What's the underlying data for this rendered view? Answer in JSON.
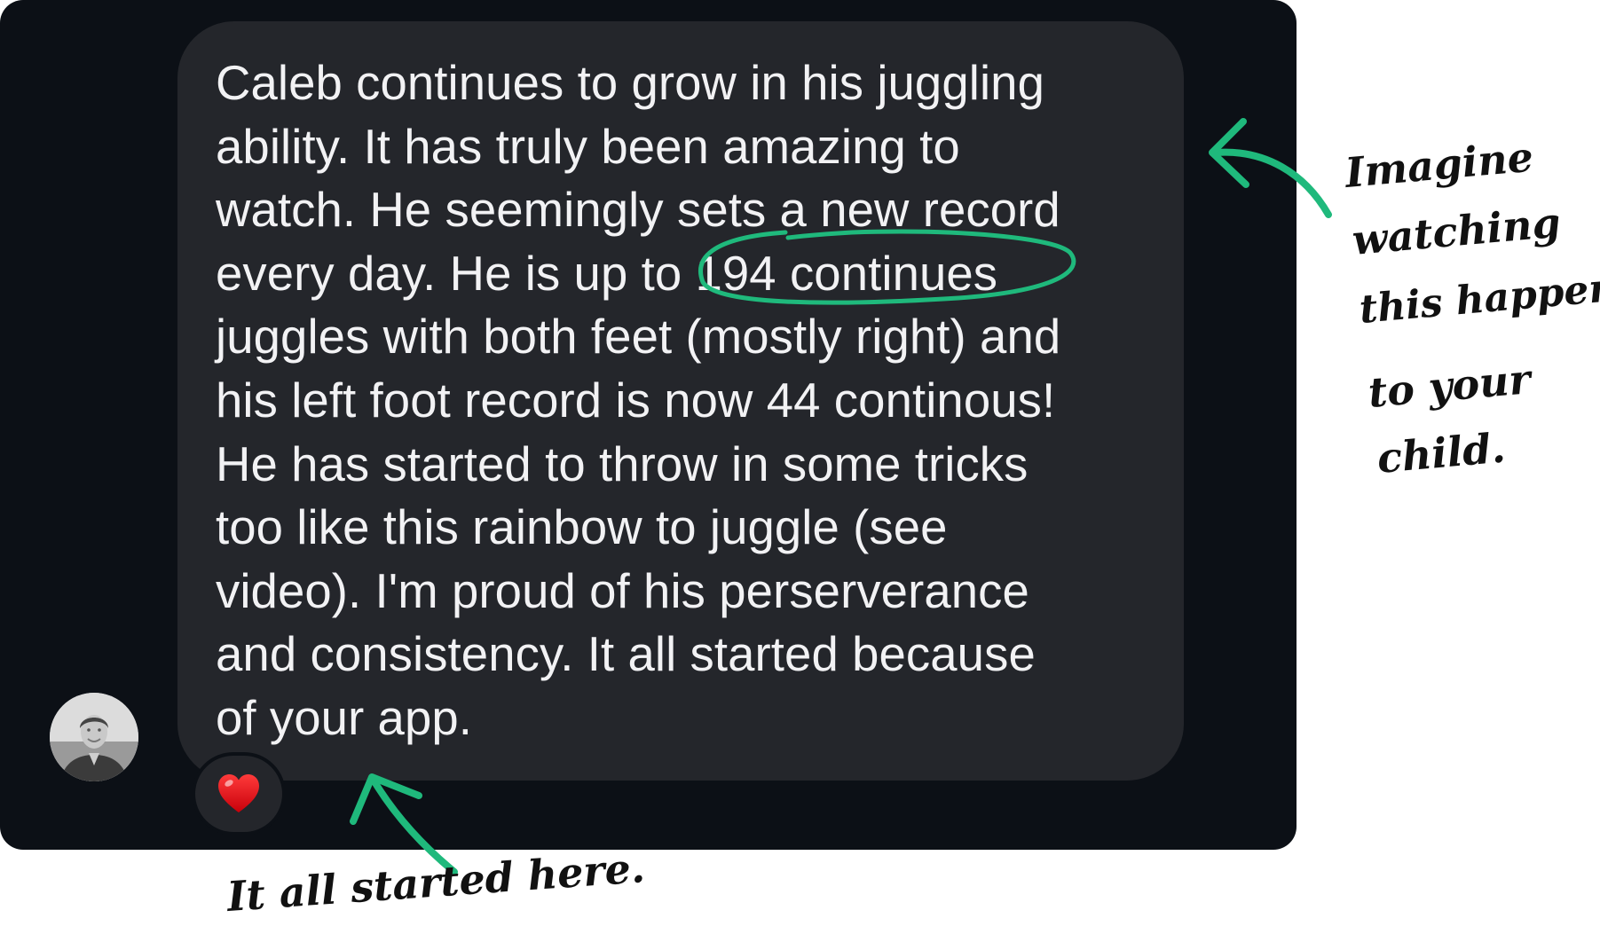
{
  "message": {
    "text": "Caleb continues to grow in his juggling\nability. It has truly been amazing to\nwatch. He seemingly sets a new record\nevery day. He is up to 194 continues\njuggles with both feet (mostly right) and\nhis left foot record is now 44 continous!\nHe has started to throw in some tricks\ntoo like this rainbow to juggle (see\nvideo). I'm proud of his perserverance\nand consistency. It all started because\nof your app."
  },
  "reaction": {
    "icon": "heart-icon",
    "color": "#e8141b"
  },
  "annotations": {
    "accent_color": "#1fb97c",
    "right_note": [
      "Imagine",
      "watching",
      "this happen",
      "to your",
      "child."
    ],
    "bottom_note": "It all started here."
  }
}
